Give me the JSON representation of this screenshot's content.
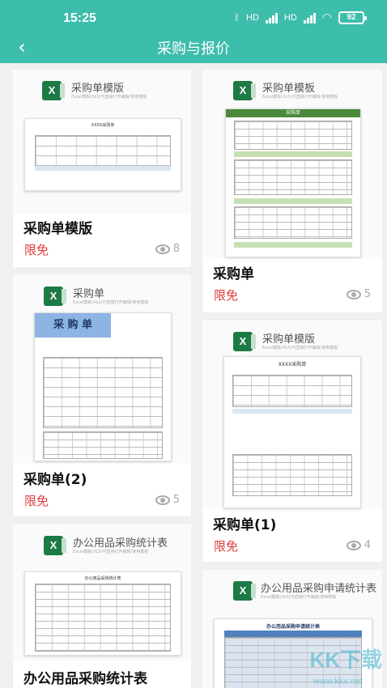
{
  "status_bar": {
    "time": "15:25",
    "bluetooth_icon": "bluetooth-icon",
    "signal_1_label": "HD",
    "signal_2_label": "HD",
    "wifi_icon": "wifi-icon",
    "battery": "92"
  },
  "header": {
    "back_icon": "chevron-left-icon",
    "title": "采购与报价"
  },
  "colors": {
    "accent": "#3dbdab",
    "free_badge": "#e03c3c",
    "excel_green": "#1e7a45"
  },
  "cards": [
    {
      "name": "采购单模版",
      "thumb_title": "采购单模版",
      "thumb_subtitle": "Excel模板(XLS)可直接打开编辑/使用模板",
      "sheet_heading": "XXXX采购单",
      "badge": "限免",
      "views": "8"
    },
    {
      "name": "采购单",
      "thumb_title": "采购单模板",
      "thumb_subtitle": "Excel模板(XLS)可直接打开编辑/使用模板",
      "sheet_heading": "采购单",
      "badge": "限免",
      "views": "5"
    },
    {
      "name": "采购单(2)",
      "thumb_title": "采购单",
      "thumb_subtitle": "Excel模板(XLS)可直接打开编辑/使用模板",
      "sheet_heading": "采 购 单",
      "badge": "限免",
      "views": "5"
    },
    {
      "name": "采购单(1)",
      "thumb_title": "采购单模版",
      "thumb_subtitle": "Excel模板(XLS)可直接打开编辑/使用模板",
      "sheet_heading": "XXXX采购单",
      "badge": "限免",
      "views": "4"
    },
    {
      "name": "办公用品采购统计表",
      "thumb_title": "办公用品采购统计表",
      "thumb_subtitle": "Excel模板(XLS)可直接打开编辑/使用模板",
      "sheet_heading": "办公用品采购统计表",
      "badge": "",
      "views": ""
    },
    {
      "name": "",
      "thumb_title": "办公用品采购申请统计表",
      "thumb_subtitle": "Excel模板(XLS)可直接打开编辑/使用模板",
      "sheet_heading": "办公用品采购申请统计表",
      "badge": "",
      "views": ""
    }
  ],
  "watermark": {
    "logo": "KK下载",
    "url": "www.kkx.net"
  }
}
